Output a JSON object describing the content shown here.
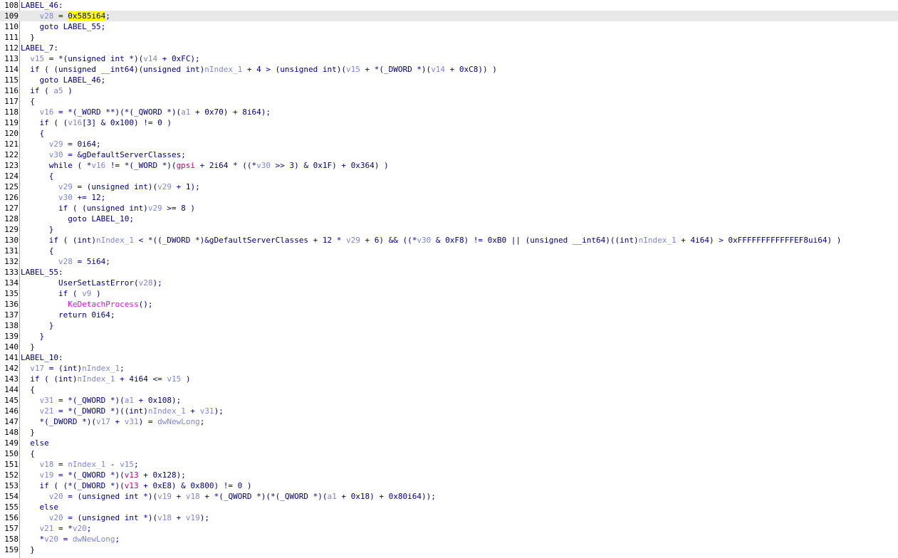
{
  "editor": {
    "colors": {
      "text": "#000080",
      "variable": "#7e86d6",
      "import": "#ff00ff",
      "global": "#c10080",
      "highlight_line": "#e8e8e8",
      "search_highlight": "#ffff00",
      "gutter_border": "#9aa2c4"
    },
    "selected_line": "109",
    "lines": [
      {
        "num": "108",
        "tokens": [
          {
            "t": "LABEL_46:",
            "c": ""
          }
        ]
      },
      {
        "num": "109",
        "tokens": [
          {
            "t": "    ",
            "c": ""
          },
          {
            "t": "v28",
            "c": "v"
          },
          {
            "t": " = ",
            "c": ""
          },
          {
            "t": "0x585i64",
            "c": "s"
          },
          {
            "t": ";",
            "c": ""
          }
        ]
      },
      {
        "num": "110",
        "tokens": [
          {
            "t": "    goto LABEL_55;",
            "c": ""
          }
        ]
      },
      {
        "num": "111",
        "tokens": [
          {
            "t": "  }",
            "c": ""
          }
        ]
      },
      {
        "num": "112",
        "tokens": [
          {
            "t": "LABEL_7:",
            "c": ""
          }
        ]
      },
      {
        "num": "113",
        "tokens": [
          {
            "t": "  ",
            "c": ""
          },
          {
            "t": "v15",
            "c": "v"
          },
          {
            "t": " = *(unsigned int *)(",
            "c": ""
          },
          {
            "t": "v14",
            "c": "v"
          },
          {
            "t": " + 0xFC);",
            "c": ""
          }
        ]
      },
      {
        "num": "114",
        "tokens": [
          {
            "t": "  if ( (unsigned __int64)(unsigned int)",
            "c": ""
          },
          {
            "t": "nIndex_1",
            "c": "v"
          },
          {
            "t": " + 4 > (unsigned int)(",
            "c": ""
          },
          {
            "t": "v15",
            "c": "v"
          },
          {
            "t": " + *(_DWORD *)(",
            "c": ""
          },
          {
            "t": "v14",
            "c": "v"
          },
          {
            "t": " + 0xC8)) )",
            "c": ""
          }
        ]
      },
      {
        "num": "115",
        "tokens": [
          {
            "t": "    goto LABEL_46;",
            "c": ""
          }
        ]
      },
      {
        "num": "116",
        "tokens": [
          {
            "t": "  if ( ",
            "c": ""
          },
          {
            "t": "a5",
            "c": "v"
          },
          {
            "t": " )",
            "c": ""
          }
        ]
      },
      {
        "num": "117",
        "tokens": [
          {
            "t": "  {",
            "c": ""
          }
        ]
      },
      {
        "num": "118",
        "tokens": [
          {
            "t": "    ",
            "c": ""
          },
          {
            "t": "v16",
            "c": "v"
          },
          {
            "t": " = *(_WORD **)(*(_QWORD *)(",
            "c": ""
          },
          {
            "t": "a1",
            "c": "v"
          },
          {
            "t": " + 0x70) + 8i64);",
            "c": ""
          }
        ]
      },
      {
        "num": "119",
        "tokens": [
          {
            "t": "    if ( (",
            "c": ""
          },
          {
            "t": "v16",
            "c": "v"
          },
          {
            "t": "[3] & 0x100) != 0 )",
            "c": ""
          }
        ]
      },
      {
        "num": "120",
        "tokens": [
          {
            "t": "    {",
            "c": ""
          }
        ]
      },
      {
        "num": "121",
        "tokens": [
          {
            "t": "      ",
            "c": ""
          },
          {
            "t": "v29",
            "c": "v"
          },
          {
            "t": " = 0i64;",
            "c": ""
          }
        ]
      },
      {
        "num": "122",
        "tokens": [
          {
            "t": "      ",
            "c": ""
          },
          {
            "t": "v30",
            "c": "v"
          },
          {
            "t": " = &gDefaultServerClasses;",
            "c": ""
          }
        ]
      },
      {
        "num": "123",
        "tokens": [
          {
            "t": "      while ( *",
            "c": ""
          },
          {
            "t": "v16",
            "c": "v"
          },
          {
            "t": " != *(_WORD *)(",
            "c": ""
          },
          {
            "t": "gpsi",
            "c": "g"
          },
          {
            "t": " + 2i64 * ((*",
            "c": ""
          },
          {
            "t": "v30",
            "c": "v"
          },
          {
            "t": " >> 3) & 0x1F) + 0x364) )",
            "c": ""
          }
        ]
      },
      {
        "num": "124",
        "tokens": [
          {
            "t": "      {",
            "c": ""
          }
        ]
      },
      {
        "num": "125",
        "tokens": [
          {
            "t": "        ",
            "c": ""
          },
          {
            "t": "v29",
            "c": "v"
          },
          {
            "t": " = (unsigned int)(",
            "c": ""
          },
          {
            "t": "v29",
            "c": "v"
          },
          {
            "t": " + 1);",
            "c": ""
          }
        ]
      },
      {
        "num": "126",
        "tokens": [
          {
            "t": "        ",
            "c": ""
          },
          {
            "t": "v30",
            "c": "v"
          },
          {
            "t": " += 12;",
            "c": ""
          }
        ]
      },
      {
        "num": "127",
        "tokens": [
          {
            "t": "        if ( (unsigned int)",
            "c": ""
          },
          {
            "t": "v29",
            "c": "v"
          },
          {
            "t": " >= 8 )",
            "c": ""
          }
        ]
      },
      {
        "num": "128",
        "tokens": [
          {
            "t": "          goto LABEL_10;",
            "c": ""
          }
        ]
      },
      {
        "num": "129",
        "tokens": [
          {
            "t": "      }",
            "c": ""
          }
        ]
      },
      {
        "num": "130",
        "tokens": [
          {
            "t": "      if ( (int)",
            "c": ""
          },
          {
            "t": "nIndex_1",
            "c": "v"
          },
          {
            "t": " < *((_DWORD *)&gDefaultServerClasses + 12 * ",
            "c": ""
          },
          {
            "t": "v29",
            "c": "v"
          },
          {
            "t": " + 6) && ((*",
            "c": ""
          },
          {
            "t": "v30",
            "c": "v"
          },
          {
            "t": " & 0xF8) != 0xB0 || (unsigned __int64)((int)",
            "c": ""
          },
          {
            "t": "nIndex_1",
            "c": "v"
          },
          {
            "t": " + 4i64) > 0xFFFFFFFFFFFFEF8ui64) )",
            "c": ""
          }
        ]
      },
      {
        "num": "131",
        "tokens": [
          {
            "t": "      {",
            "c": ""
          }
        ]
      },
      {
        "num": "132",
        "tokens": [
          {
            "t": "        ",
            "c": ""
          },
          {
            "t": "v28",
            "c": "v"
          },
          {
            "t": " = 5i64;",
            "c": ""
          }
        ]
      },
      {
        "num": "133",
        "tokens": [
          {
            "t": "LABEL_55:",
            "c": ""
          }
        ]
      },
      {
        "num": "134",
        "tokens": [
          {
            "t": "        UserSetLastError(",
            "c": ""
          },
          {
            "t": "v28",
            "c": "v"
          },
          {
            "t": ");",
            "c": ""
          }
        ]
      },
      {
        "num": "135",
        "tokens": [
          {
            "t": "        if ( ",
            "c": ""
          },
          {
            "t": "v9",
            "c": "v"
          },
          {
            "t": " )",
            "c": ""
          }
        ]
      },
      {
        "num": "136",
        "tokens": [
          {
            "t": "          ",
            "c": ""
          },
          {
            "t": "KeDetachProcess",
            "c": "f"
          },
          {
            "t": "();",
            "c": ""
          }
        ]
      },
      {
        "num": "137",
        "tokens": [
          {
            "t": "        return 0i64;",
            "c": ""
          }
        ]
      },
      {
        "num": "138",
        "tokens": [
          {
            "t": "      }",
            "c": ""
          }
        ]
      },
      {
        "num": "139",
        "tokens": [
          {
            "t": "    }",
            "c": ""
          }
        ]
      },
      {
        "num": "140",
        "tokens": [
          {
            "t": "  }",
            "c": ""
          }
        ]
      },
      {
        "num": "141",
        "tokens": [
          {
            "t": "LABEL_10:",
            "c": ""
          }
        ]
      },
      {
        "num": "142",
        "tokens": [
          {
            "t": "  ",
            "c": ""
          },
          {
            "t": "v17",
            "c": "v"
          },
          {
            "t": " = (int)",
            "c": ""
          },
          {
            "t": "nIndex_1",
            "c": "v"
          },
          {
            "t": ";",
            "c": ""
          }
        ]
      },
      {
        "num": "143",
        "tokens": [
          {
            "t": "  if ( (int)",
            "c": ""
          },
          {
            "t": "nIndex_1",
            "c": "v"
          },
          {
            "t": " + 4i64 <= ",
            "c": ""
          },
          {
            "t": "v15",
            "c": "v"
          },
          {
            "t": " )",
            "c": ""
          }
        ]
      },
      {
        "num": "144",
        "tokens": [
          {
            "t": "  {",
            "c": ""
          }
        ]
      },
      {
        "num": "145",
        "tokens": [
          {
            "t": "    ",
            "c": ""
          },
          {
            "t": "v31",
            "c": "v"
          },
          {
            "t": " = *(_QWORD *)(",
            "c": ""
          },
          {
            "t": "a1",
            "c": "v"
          },
          {
            "t": " + 0x108);",
            "c": ""
          }
        ]
      },
      {
        "num": "146",
        "tokens": [
          {
            "t": "    ",
            "c": ""
          },
          {
            "t": "v21",
            "c": "v"
          },
          {
            "t": " = *(_DWORD *)((int)",
            "c": ""
          },
          {
            "t": "nIndex_1",
            "c": "v"
          },
          {
            "t": " + ",
            "c": ""
          },
          {
            "t": "v31",
            "c": "v"
          },
          {
            "t": ");",
            "c": ""
          }
        ]
      },
      {
        "num": "147",
        "tokens": [
          {
            "t": "    *(_DWORD *)(",
            "c": ""
          },
          {
            "t": "v17",
            "c": "v"
          },
          {
            "t": " + ",
            "c": ""
          },
          {
            "t": "v31",
            "c": "v"
          },
          {
            "t": ") = ",
            "c": ""
          },
          {
            "t": "dwNewLong",
            "c": "v"
          },
          {
            "t": ";",
            "c": ""
          }
        ]
      },
      {
        "num": "148",
        "tokens": [
          {
            "t": "  }",
            "c": ""
          }
        ]
      },
      {
        "num": "149",
        "tokens": [
          {
            "t": "  else",
            "c": ""
          }
        ]
      },
      {
        "num": "150",
        "tokens": [
          {
            "t": "  {",
            "c": ""
          }
        ]
      },
      {
        "num": "151",
        "tokens": [
          {
            "t": "    ",
            "c": ""
          },
          {
            "t": "v18",
            "c": "v"
          },
          {
            "t": " = ",
            "c": ""
          },
          {
            "t": "nIndex_1",
            "c": "v"
          },
          {
            "t": " - ",
            "c": ""
          },
          {
            "t": "v15",
            "c": "v"
          },
          {
            "t": ";",
            "c": ""
          }
        ]
      },
      {
        "num": "152",
        "tokens": [
          {
            "t": "    ",
            "c": ""
          },
          {
            "t": "v19",
            "c": "v"
          },
          {
            "t": " = *(_QWORD *)(",
            "c": ""
          },
          {
            "t": "v13",
            "c": "g"
          },
          {
            "t": " + 0x128);",
            "c": ""
          }
        ]
      },
      {
        "num": "153",
        "tokens": [
          {
            "t": "    if ( (*(_DWORD *)(",
            "c": ""
          },
          {
            "t": "v13",
            "c": "g"
          },
          {
            "t": " + 0xE8) & 0x800) != 0 )",
            "c": ""
          }
        ]
      },
      {
        "num": "154",
        "tokens": [
          {
            "t": "      ",
            "c": ""
          },
          {
            "t": "v20",
            "c": "v"
          },
          {
            "t": " = (unsigned int *)(",
            "c": ""
          },
          {
            "t": "v19",
            "c": "v"
          },
          {
            "t": " + ",
            "c": ""
          },
          {
            "t": "v18",
            "c": "v"
          },
          {
            "t": " + *(_QWORD *)(*(_QWORD *)(",
            "c": ""
          },
          {
            "t": "a1",
            "c": "v"
          },
          {
            "t": " + 0x18) + 0x80i64));",
            "c": ""
          }
        ]
      },
      {
        "num": "155",
        "tokens": [
          {
            "t": "    else",
            "c": ""
          }
        ]
      },
      {
        "num": "156",
        "tokens": [
          {
            "t": "      ",
            "c": ""
          },
          {
            "t": "v20",
            "c": "v"
          },
          {
            "t": " = (unsigned int *)(",
            "c": ""
          },
          {
            "t": "v18",
            "c": "v"
          },
          {
            "t": " + ",
            "c": ""
          },
          {
            "t": "v19",
            "c": "v"
          },
          {
            "t": ");",
            "c": ""
          }
        ]
      },
      {
        "num": "157",
        "tokens": [
          {
            "t": "    ",
            "c": ""
          },
          {
            "t": "v21",
            "c": "v"
          },
          {
            "t": " = *",
            "c": ""
          },
          {
            "t": "v20",
            "c": "v"
          },
          {
            "t": ";",
            "c": ""
          }
        ]
      },
      {
        "num": "158",
        "tokens": [
          {
            "t": "    *",
            "c": ""
          },
          {
            "t": "v20",
            "c": "v"
          },
          {
            "t": " = ",
            "c": ""
          },
          {
            "t": "dwNewLong",
            "c": "v"
          },
          {
            "t": ";",
            "c": ""
          }
        ]
      },
      {
        "num": "159",
        "tokens": [
          {
            "t": "  }",
            "c": ""
          }
        ]
      }
    ]
  }
}
